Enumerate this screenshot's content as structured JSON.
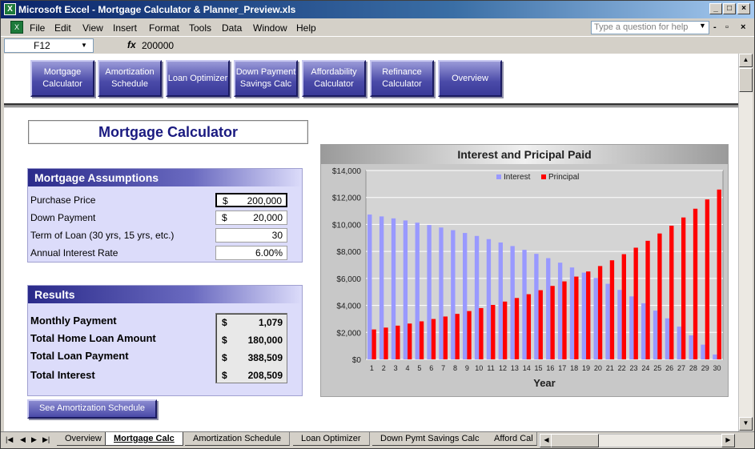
{
  "window": {
    "title": "Microsoft Excel - Mortgage Calculator & Planner_Preview.xls"
  },
  "menu": {
    "items": [
      "File",
      "Edit",
      "View",
      "Insert",
      "Format",
      "Tools",
      "Data",
      "Window",
      "Help"
    ],
    "question_placeholder": "Type a question for help"
  },
  "formula_bar": {
    "cell_ref": "F12",
    "fx": "fx",
    "value": "200000"
  },
  "nav_buttons": [
    "Mortgage Calculator",
    "Amortization Schedule",
    "Loan Optimizer",
    "Down Payment Savings Calc",
    "Affordability Calculator",
    "Refinance Calculator",
    "Overview"
  ],
  "page_title": "Mortgage Calculator",
  "assumptions": {
    "heading": "Mortgage Assumptions",
    "rows": [
      {
        "label": "Purchase Price",
        "prefix": "$",
        "value": "200,000"
      },
      {
        "label": "Down Payment",
        "prefix": "$",
        "value": "20,000"
      },
      {
        "label": "Term of Loan (30 yrs, 15 yrs, etc.)",
        "prefix": "",
        "value": "30"
      },
      {
        "label": "Annual Interest Rate",
        "prefix": "",
        "value": "6.00%"
      }
    ]
  },
  "results": {
    "heading": "Results",
    "rows": [
      {
        "label": "Monthly Payment",
        "prefix": "$",
        "value": "1,079"
      },
      {
        "label": "Total Home Loan Amount",
        "prefix": "$",
        "value": "180,000"
      },
      {
        "label": "Total Loan Payment",
        "prefix": "$",
        "value": "388,509"
      },
      {
        "label": "Total Interest",
        "prefix": "$",
        "value": "208,509"
      }
    ]
  },
  "amortization_button": "See Amortization Schedule",
  "chart_data": {
    "type": "bar",
    "title": "Interest and Pricipal Paid",
    "xlabel": "Year",
    "ylabel": "",
    "ylim": [
      0,
      14000
    ],
    "yticks": [
      "$0",
      "$2,000",
      "$4,000",
      "$6,000",
      "$8,000",
      "$10,000",
      "$12,000",
      "$14,000"
    ],
    "legend_position": "top",
    "categories": [
      "1",
      "2",
      "3",
      "4",
      "5",
      "6",
      "7",
      "8",
      "9",
      "10",
      "11",
      "12",
      "13",
      "14",
      "15",
      "16",
      "17",
      "18",
      "19",
      "20",
      "21",
      "22",
      "23",
      "24",
      "25",
      "26",
      "27",
      "28",
      "29",
      "30"
    ],
    "series": [
      {
        "name": "Interest",
        "color": "#9999ff",
        "values": [
          10733,
          10596,
          10450,
          10296,
          10131,
          9957,
          9772,
          9576,
          9368,
          9147,
          8912,
          8663,
          8399,
          8118,
          7820,
          7503,
          7167,
          6810,
          6431,
          6029,
          5602,
          5149,
          4668,
          4158,
          3615,
          3040,
          2429,
          1780,
          1091,
          361
        ]
      },
      {
        "name": "Principal",
        "color": "#ff0000",
        "values": [
          2217,
          2354,
          2499,
          2654,
          2818,
          2992,
          3176,
          3372,
          3580,
          3801,
          4035,
          4284,
          4549,
          4829,
          5127,
          5444,
          5780,
          6136,
          6515,
          6917,
          7343,
          7796,
          8277,
          8788,
          9330,
          9906,
          10517,
          11166,
          11855,
          12586
        ]
      }
    ]
  },
  "sheet_tabs": [
    "Overview",
    "Mortgage Calc",
    "Amortization Schedule",
    "Loan Optimizer",
    "Down Pymt Savings Calc",
    "Afford Cal"
  ],
  "colors": {
    "accent": "#2a2a8a",
    "panel_bg": "#dcdcfa",
    "title_text": "#1a1a80"
  }
}
